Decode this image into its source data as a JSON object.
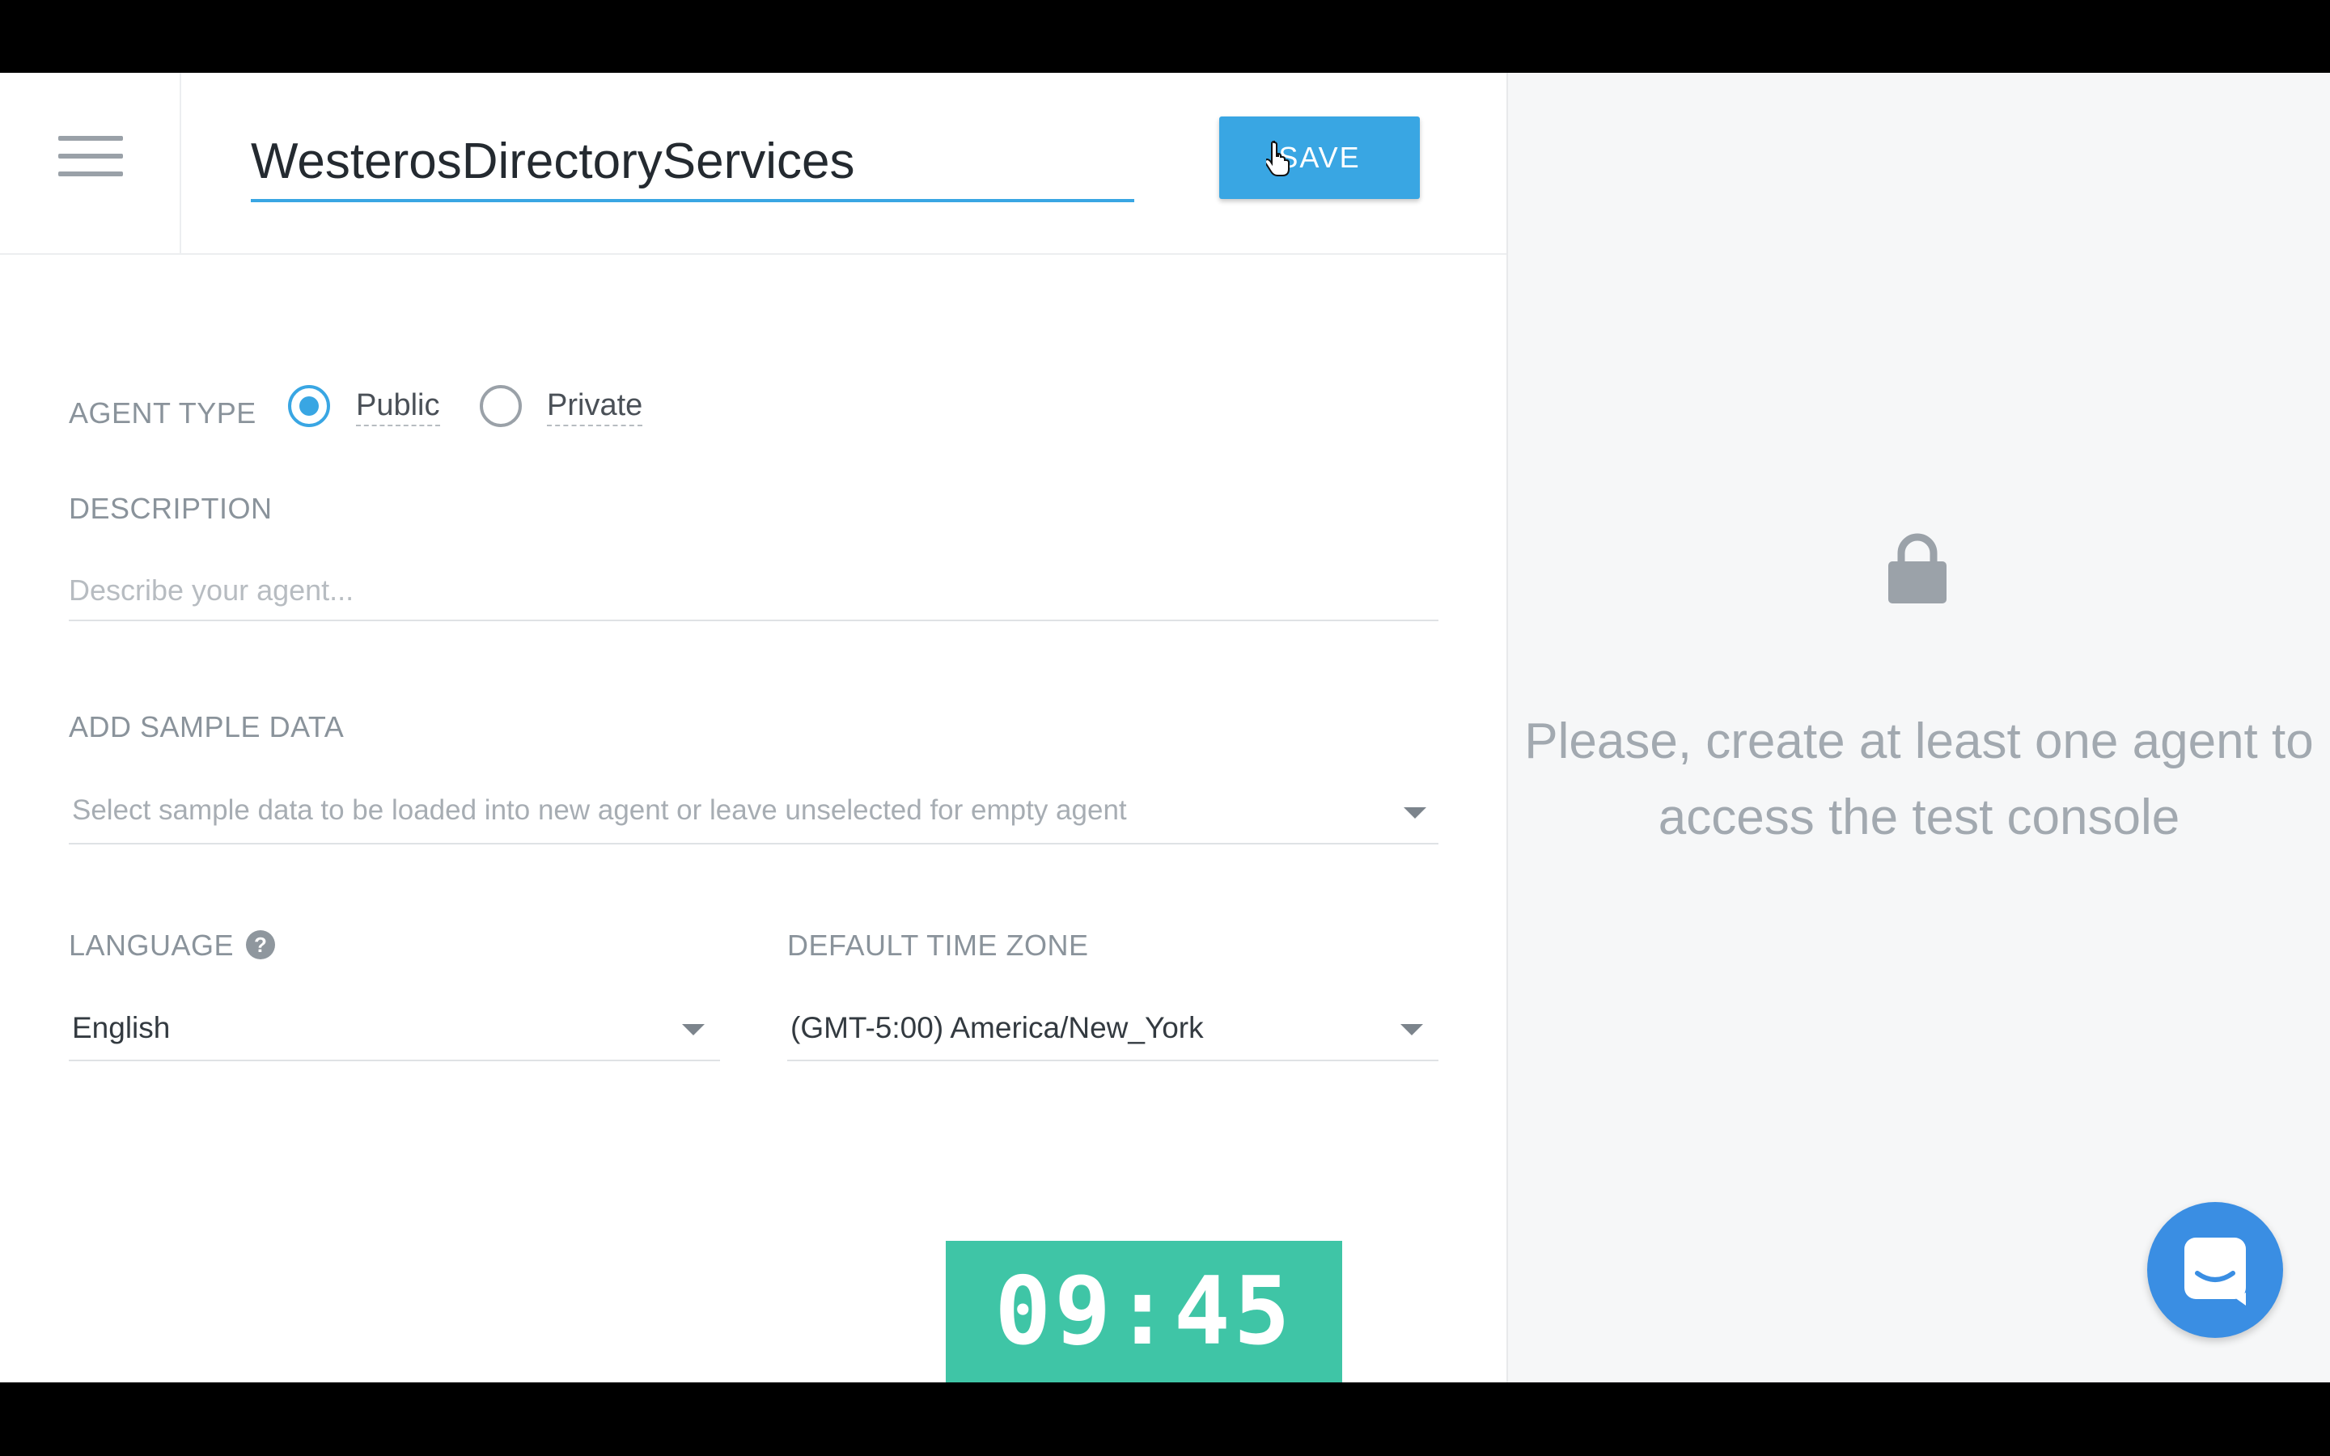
{
  "header": {
    "agent_name": "WesterosDirectoryServices",
    "save_label": "SAVE"
  },
  "agent_type": {
    "label": "AGENT TYPE",
    "options": [
      {
        "label": "Public",
        "selected": true
      },
      {
        "label": "Private",
        "selected": false
      }
    ]
  },
  "description": {
    "label": "DESCRIPTION",
    "placeholder": "Describe your agent...",
    "value": ""
  },
  "sample_data": {
    "label": "ADD SAMPLE DATA",
    "placeholder": "Select sample data to be loaded into new agent or leave unselected for empty agent"
  },
  "language": {
    "label": "LANGUAGE",
    "help_glyph": "?",
    "value": "English"
  },
  "time_zone": {
    "label": "DEFAULT TIME ZONE",
    "value": "(GMT-5:00) America/New_York"
  },
  "console": {
    "message": "Please, create at least one agent to access the test console"
  },
  "timer": "09:45",
  "colors": {
    "accent": "#39a6e3",
    "timer_bg": "#3fc5a6",
    "chat_bg": "#3a8ee3",
    "console_bg": "#f6f7f8"
  },
  "icons": [
    "menu-icon",
    "lock-icon",
    "help-icon",
    "chevron-down-icon",
    "chat-icon",
    "cursor-icon"
  ]
}
